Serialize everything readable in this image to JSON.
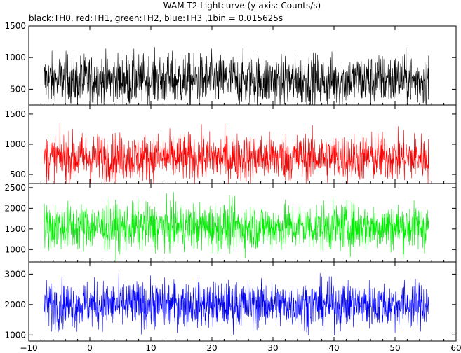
{
  "title": "WAM T2 Lightcurve (y-axis: Counts/s)",
  "subtitle": "black:TH0, red:TH1, green:TH2, blue:TH3 ,1bin = 0.015625s",
  "chart_data": {
    "type": "line",
    "x_range": [
      -10,
      60
    ],
    "x_ticks": [
      -10,
      0,
      10,
      20,
      30,
      40,
      50,
      60
    ],
    "x_tick_labels": [
      "−10",
      "0",
      "10",
      "20",
      "30",
      "40",
      "50",
      "60"
    ],
    "data_x_span": [
      -7.5,
      55.5
    ],
    "bin_seconds": 0.015625,
    "grid": false,
    "panels": [
      {
        "series": "TH0",
        "color": "#000000",
        "y_range": [
          250,
          1500
        ],
        "y_ticks": [
          500,
          1000,
          1500
        ],
        "y_tick_labels": [
          "500",
          "1000",
          "1500"
        ],
        "mean": 640,
        "min": 150,
        "max": 1550
      },
      {
        "series": "TH1",
        "color": "#ff0000",
        "y_range": [
          350,
          1650
        ],
        "y_ticks": [
          500,
          1000,
          1500
        ],
        "y_tick_labels": [
          "500",
          "1000",
          "1500"
        ],
        "mean": 780,
        "min": 250,
        "max": 1600
      },
      {
        "series": "TH2",
        "color": "#00ee00",
        "y_range": [
          700,
          2600
        ],
        "y_ticks": [
          1000,
          1500,
          2000,
          2500
        ],
        "y_tick_labels": [
          "1000",
          "1500",
          "2000",
          "2500"
        ],
        "mean": 1550,
        "min": 650,
        "max": 2600
      },
      {
        "series": "TH3",
        "color": "#0000ff",
        "y_range": [
          800,
          3400
        ],
        "y_ticks": [
          1000,
          2000,
          3000
        ],
        "y_tick_labels": [
          "1000",
          "2000",
          "3000"
        ],
        "mean": 2000,
        "min": 700,
        "max": 3300
      }
    ]
  }
}
